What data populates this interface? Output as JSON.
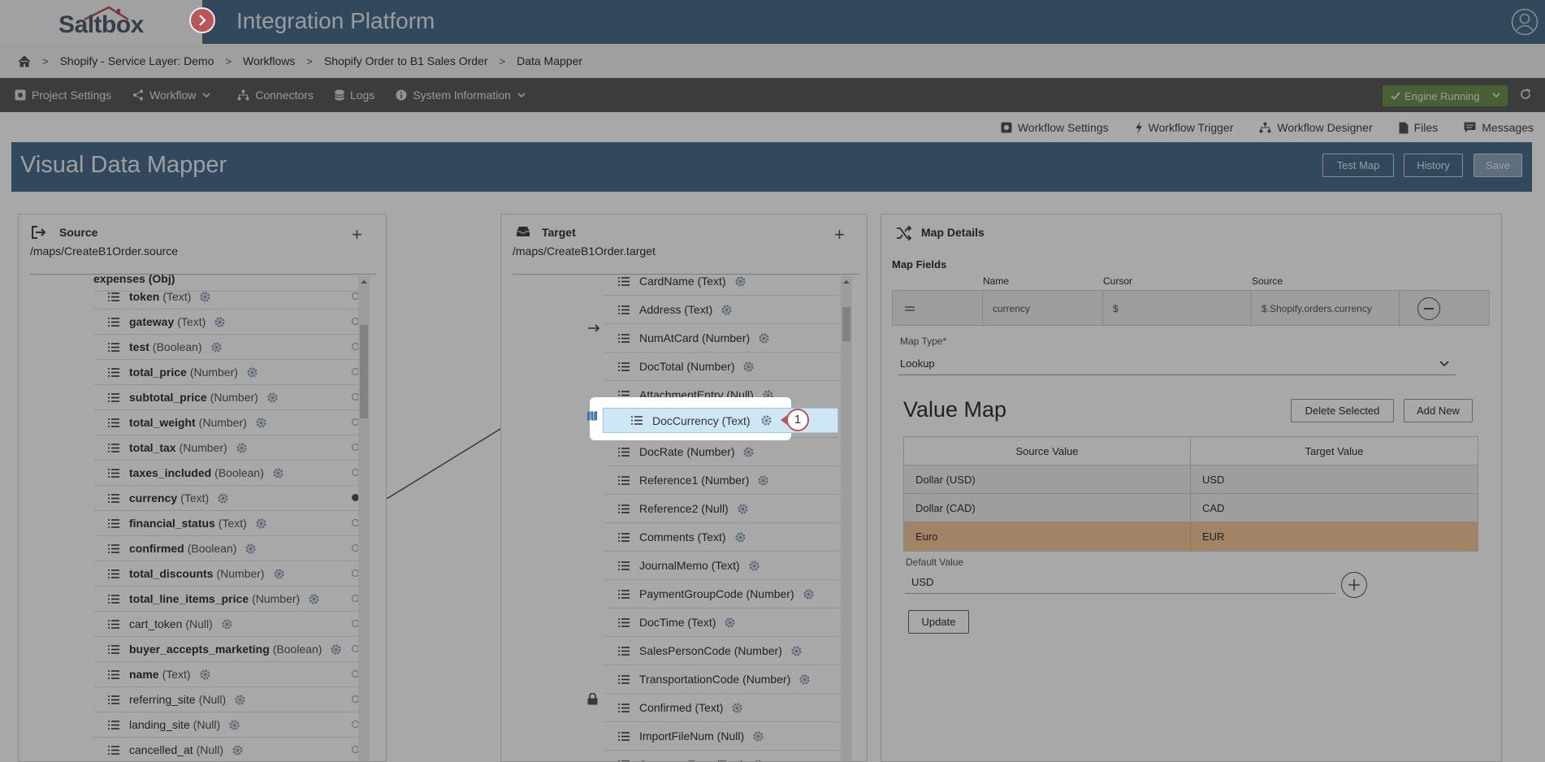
{
  "header": {
    "logo": "Saltbox",
    "title": "Integration Platform"
  },
  "breadcrumb": [
    "Shopify - Service Layer: Demo",
    "Workflows",
    "Shopify Order to B1 Sales Order",
    "Data Mapper"
  ],
  "toolbar": {
    "project_settings": "Project Settings",
    "workflow": "Workflow",
    "connectors": "Connectors",
    "logs": "Logs",
    "system_information": "System Information",
    "engine_status": "Engine Running"
  },
  "subnav": {
    "workflow_settings": "Workflow Settings",
    "workflow_trigger": "Workflow Trigger",
    "workflow_designer": "Workflow Designer",
    "files": "Files",
    "messages": "Messages"
  },
  "banner": {
    "title": "Visual Data Mapper",
    "test_map": "Test Map",
    "history": "History",
    "save": "Save"
  },
  "source": {
    "title": "Source",
    "path": "/maps/CreateB1Order.source",
    "partial_top": "expenses (Obj)",
    "rows": [
      {
        "name": "token",
        "type": "(Text)"
      },
      {
        "name": "gateway",
        "type": "(Text)"
      },
      {
        "name": "test",
        "type": "(Boolean)"
      },
      {
        "name": "total_price",
        "type": "(Number)"
      },
      {
        "name": "subtotal_price",
        "type": "(Number)"
      },
      {
        "name": "total_weight",
        "type": "(Number)"
      },
      {
        "name": "total_tax",
        "type": "(Number)"
      },
      {
        "name": "taxes_included",
        "type": "(Boolean)"
      },
      {
        "name": "currency",
        "type": "(Text)"
      },
      {
        "name": "financial_status",
        "type": "(Text)"
      },
      {
        "name": "confirmed",
        "type": "(Boolean)"
      },
      {
        "name": "total_discounts",
        "type": "(Number)"
      },
      {
        "name": "total_line_items_price",
        "type": "(Number)"
      },
      {
        "name": "cart_token",
        "type": "(Null)"
      },
      {
        "name": "buyer_accepts_marketing",
        "type": "(Boolean)"
      },
      {
        "name": "name",
        "type": "(Text)"
      },
      {
        "name": "referring_site",
        "type": "(Null)"
      },
      {
        "name": "landing_site",
        "type": "(Null)"
      },
      {
        "name": "cancelled_at",
        "type": "(Null)"
      }
    ]
  },
  "target": {
    "title": "Target",
    "path": "/maps/CreateB1Order.target",
    "rows": [
      "CardName (Text)",
      "Address (Text)",
      "NumAtCard (Number)",
      "DocTotal (Number)",
      "AttachmentEntry (Null)",
      "DocCurrency (Text)",
      "DocRate (Number)",
      "Reference1 (Number)",
      "Reference2 (Null)",
      "Comments (Text)",
      "JournalMemo (Text)",
      "PaymentGroupCode (Number)",
      "DocTime (Text)",
      "SalesPersonCode (Number)",
      "TransportationCode (Number)",
      "Confirmed (Text)",
      "ImportFileNum (Null)",
      "SummeryType (Text)"
    ],
    "selected": "DocCurrency (Text)",
    "callout": "1"
  },
  "map_details": {
    "title": "Map Details",
    "map_fields": "Map Fields",
    "col_name": "Name",
    "col_cursor": "Cursor",
    "col_source": "Source",
    "field_name": "currency",
    "field_cursor": "$",
    "field_source": "$.Shopify.orders.currency",
    "map_type_label": "Map Type*",
    "map_type_value": "Lookup",
    "value_map_title": "Value Map",
    "delete_selected": "Delete Selected",
    "add_new": "Add New",
    "col_source_value": "Source Value",
    "col_target_value": "Target Value",
    "values": [
      {
        "source": "Dollar (USD)",
        "target": "USD"
      },
      {
        "source": "Dollar (CAD)",
        "target": "CAD"
      },
      {
        "source": "Euro",
        "target": "EUR"
      }
    ],
    "default_value_label": "Default Value",
    "default_value": "USD",
    "update": "Update"
  }
}
